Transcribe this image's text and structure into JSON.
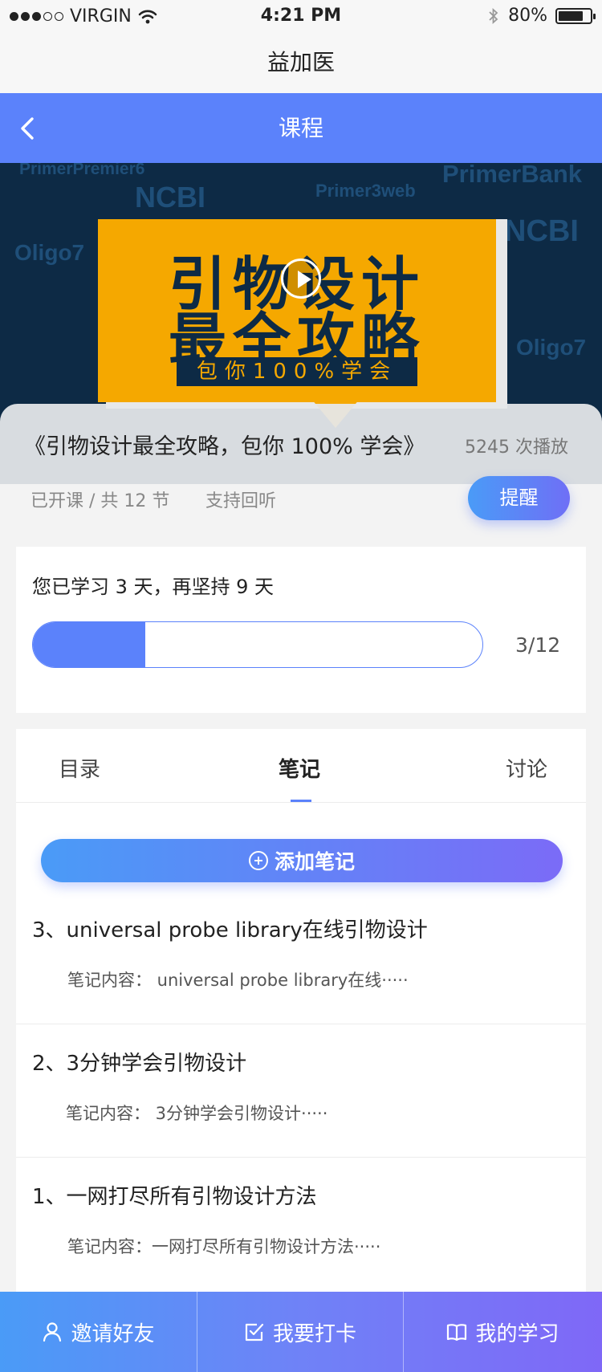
{
  "status_bar": {
    "carrier": "VIRGIN",
    "signal_bars": 3,
    "signal_total": 5,
    "time": "4:21 PM",
    "battery": "80%",
    "battery_level": 0.8
  },
  "app": {
    "name": "益加医"
  },
  "nav": {
    "title": "课程",
    "back_icon": "chevron-left-icon"
  },
  "hero": {
    "watermarks": [
      "PrimerPremier6",
      "NCBI",
      "Primer3web",
      "PrimerBank",
      "Oligo7",
      "NCBI",
      "Oligo7"
    ],
    "poster_line1": "引物设计",
    "poster_line2": "最全攻略",
    "poster_sub": "包你100%学会",
    "play_icon": "play-circle-icon",
    "colors": {
      "poster": "#f5a800",
      "background": "#0d2a45"
    }
  },
  "course": {
    "title": "《引物设计最全攻略，包你 100% 学会》",
    "play_count": "5245 次播放",
    "lessons_status": "已开课 / 共 12 节",
    "replay": "支持回听",
    "remind_button": "提醒"
  },
  "progress": {
    "text": "您已学习 3 天，再坚持 9 天",
    "count": "3/12",
    "fraction": 0.25
  },
  "tabs": [
    {
      "label": "目录",
      "active": false
    },
    {
      "label": "笔记",
      "active": true
    },
    {
      "label": "讨论",
      "active": false
    }
  ],
  "notes": {
    "add_button": "添加笔记",
    "items": [
      {
        "title": "3、universal probe library在线引物设计",
        "body": "笔记内容： universal probe library在线·····"
      },
      {
        "title": "2、3分钟学会引物设计",
        "body": "笔记内容： 3分钟学会引物设计·····"
      },
      {
        "title": "1、一网打尽所有引物设计方法",
        "body": "笔记内容：一网打尽所有引物设计方法·····"
      }
    ]
  },
  "bottom_bar": [
    {
      "label": "邀请好友",
      "icon": "user-icon"
    },
    {
      "label": "我要打卡",
      "icon": "checkbox-icon"
    },
    {
      "label": "我的学习",
      "icon": "book-icon"
    }
  ],
  "colors": {
    "accent": "#5b82fb",
    "gradient_start": "#4a9bf7",
    "gradient_end": "#7b6bf7"
  }
}
